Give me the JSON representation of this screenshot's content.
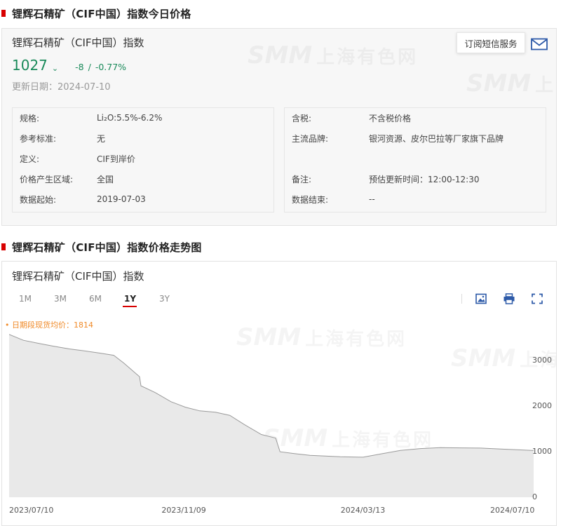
{
  "section1": {
    "title": "锂辉石精矿（CIF中国）指数今日价格"
  },
  "summary": {
    "index_name": "锂辉石精矿（CIF中国）指数",
    "price": "1027",
    "change": "-8",
    "separator": "/",
    "change_pct": "-0.77%",
    "updated": "更新日期：2024-07-10",
    "subscribe_label": "订阅短信服务",
    "watermark_brand": "SMM",
    "watermark_cn": "上海有色网",
    "trend_color": "#1a8a5a"
  },
  "spec_left": [
    {
      "k": "规格:",
      "v": "Li₂O:5.5%-6.2%"
    },
    {
      "k": "参考标准:",
      "v": "无"
    },
    {
      "k": "定义:",
      "v": "CIF到岸价"
    },
    {
      "k": "价格产生区域:",
      "v": "全国"
    },
    {
      "k": "数据起始:",
      "v": "2019-07-03"
    }
  ],
  "spec_right": [
    {
      "k": "含税:",
      "v": "不含税价格"
    },
    {
      "k": "主流品牌:",
      "v": "银河资源、皮尔巴拉等厂家旗下品牌"
    },
    {
      "k": "备注:",
      "v": "预估更新时间：12:00-12:30"
    },
    {
      "k": "数据结束:",
      "v": "--"
    }
  ],
  "section2": {
    "title": "锂辉石精矿（CIF中国）指数价格走势图"
  },
  "chart": {
    "title": "锂辉石精矿（CIF中国）指数",
    "tabs": [
      "1M",
      "3M",
      "6M",
      "1Y",
      "3Y"
    ],
    "active_tab": "1Y",
    "avg_label": "• 日期段现货均价：1814",
    "accent": "#d80000"
  },
  "chart_data": {
    "type": "area",
    "series": [
      {
        "values": [
          [
            "2023-07-10",
            3580
          ],
          [
            "2023-07-20",
            3450
          ],
          [
            "2023-07-31",
            3380
          ],
          [
            "2023-08-10",
            3320
          ],
          [
            "2023-08-21",
            3260
          ],
          [
            "2023-08-31",
            3220
          ],
          [
            "2023-09-11",
            3170
          ],
          [
            "2023-09-21",
            3120
          ],
          [
            "2023-09-28",
            2950
          ],
          [
            "2023-10-09",
            2650
          ],
          [
            "2023-10-10",
            2450
          ],
          [
            "2023-10-20",
            2300
          ],
          [
            "2023-10-31",
            2100
          ],
          [
            "2023-11-10",
            1980
          ],
          [
            "2023-11-20",
            1900
          ],
          [
            "2023-12-01",
            1870
          ],
          [
            "2023-12-11",
            1800
          ],
          [
            "2023-12-21",
            1600
          ],
          [
            "2024-01-02",
            1380
          ],
          [
            "2024-01-12",
            1300
          ],
          [
            "2024-01-15",
            1000
          ],
          [
            "2024-01-25",
            960
          ],
          [
            "2024-02-05",
            920
          ],
          [
            "2024-02-26",
            890
          ],
          [
            "2024-03-13",
            880
          ],
          [
            "2024-03-25",
            950
          ],
          [
            "2024-04-08",
            1030
          ],
          [
            "2024-04-22",
            1070
          ],
          [
            "2024-05-06",
            1090
          ],
          [
            "2024-05-20",
            1085
          ],
          [
            "2024-06-03",
            1080
          ],
          [
            "2024-06-17",
            1060
          ],
          [
            "2024-07-01",
            1040
          ],
          [
            "2024-07-10",
            1027
          ]
        ]
      }
    ],
    "x_ticks": [
      "2023/07/10",
      "2023/11/09",
      "2024/03/13",
      "2024/07/10"
    ],
    "y_ticks": [
      0,
      1000,
      2000,
      3000
    ],
    "ylim": [
      0,
      3700
    ],
    "xlim": [
      "2023-07-10",
      "2024-07-10"
    ],
    "grid": false,
    "fill_color": "#e9e9e9",
    "line_color": "#9a9a9a"
  }
}
